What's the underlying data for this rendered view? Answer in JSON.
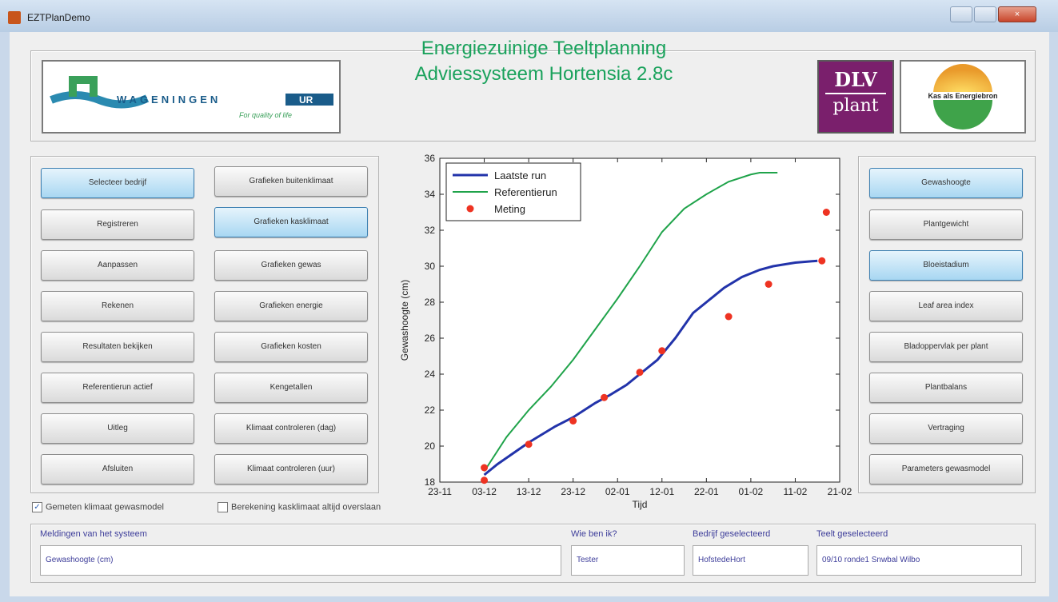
{
  "window": {
    "title": "EZTPlanDemo",
    "close_glyph": "×"
  },
  "header": {
    "title_line1": "Energiezuinige Teeltplanning",
    "title_line2": "Adviessysteem Hortensia 2.8c",
    "wur_logo_text": "WAGENINGEN",
    "wur_logo_ur": "UR",
    "wur_tagline": "For quality of life",
    "dlv_top": "DLV",
    "dlv_bottom": "plant",
    "kas_text": "Kas als Energiebron"
  },
  "left_buttons": {
    "col1": [
      "Selecteer bedrijf",
      "Registreren",
      "Aanpassen",
      "Rekenen",
      "Resultaten bekijken",
      "Referentierun actief",
      "Uitleg",
      "Afsluiten"
    ],
    "col2": [
      "Grafieken buitenklimaat",
      "Grafieken kasklimaat",
      "Grafieken gewas",
      "Grafieken energie",
      "Grafieken kosten",
      "Kengetallen",
      "Klimaat controleren (dag)",
      "Klimaat controleren (uur)"
    ]
  },
  "right_buttons": [
    "Gewashoogte",
    "Plantgewicht",
    "Bloeistadium",
    "Leaf area index",
    "Bladoppervlak per plant",
    "Plantbalans",
    "Vertraging",
    "Parameters gewasmodel"
  ],
  "checkboxes": {
    "gemeten": {
      "label": "Gemeten klimaat gewasmodel",
      "checked": true,
      "mark": "✓"
    },
    "berekening": {
      "label": "Berekening kasklimaat altijd overslaan",
      "checked": false
    }
  },
  "status": {
    "meldingen_label": "Meldingen van het systeem",
    "meldingen_value": "Gewashoogte (cm)",
    "wie_label": "Wie ben ik?",
    "wie_value": "Tester",
    "bedrijf_label": "Bedrijf geselecteerd",
    "bedrijf_value": "HofstedeHort",
    "teelt_label": "Teelt geselecteerd",
    "teelt_value": "09/10 ronde1 Snwbal Wilbo"
  },
  "colors": {
    "accent_green": "#1aa25c",
    "series_blue": "#2233aa",
    "series_green": "#1fa34a",
    "meting_red": "#ee3322"
  },
  "chart_data": {
    "type": "line",
    "xlabel": "Tijd",
    "ylabel": "Gewashoogte (cm)",
    "ylim": [
      18,
      36
    ],
    "yticks": [
      18,
      20,
      22,
      24,
      26,
      28,
      30,
      32,
      34,
      36
    ],
    "xticks": [
      "23-11",
      "03-12",
      "13-12",
      "23-12",
      "02-01",
      "12-01",
      "22-01",
      "01-02",
      "11-02",
      "21-02"
    ],
    "xlim": [
      0,
      90
    ],
    "grid": false,
    "legend_position": "top-left",
    "series": [
      {
        "name": "Laatste run",
        "style": "line",
        "color": "#2233aa",
        "x": [
          10,
          13,
          20,
          26,
          30,
          35,
          38,
          42,
          45,
          49,
          53,
          57,
          60,
          64,
          68,
          72,
          75,
          80,
          85
        ],
        "y": [
          18.4,
          19.0,
          20.2,
          21.1,
          21.6,
          22.4,
          22.8,
          23.4,
          24.0,
          24.8,
          26.0,
          27.4,
          28.0,
          28.8,
          29.4,
          29.8,
          30.0,
          30.2,
          30.3
        ]
      },
      {
        "name": "Referentierun",
        "style": "line",
        "color": "#1fa34a",
        "x": [
          10,
          15,
          20,
          25,
          30,
          35,
          40,
          45,
          50,
          55,
          60,
          65,
          70,
          72,
          76
        ],
        "y": [
          18.6,
          20.5,
          22.0,
          23.3,
          24.8,
          26.5,
          28.2,
          30.0,
          31.9,
          33.2,
          34.0,
          34.7,
          35.1,
          35.2,
          35.2
        ]
      },
      {
        "name": "Meting",
        "style": "marker",
        "color": "#ee3322",
        "x": [
          10,
          10,
          20,
          30,
          37,
          45,
          50,
          65,
          74,
          86,
          87
        ],
        "y": [
          18.1,
          18.8,
          20.1,
          21.4,
          22.7,
          24.1,
          25.3,
          27.2,
          29.0,
          30.3,
          33.0
        ]
      }
    ]
  }
}
